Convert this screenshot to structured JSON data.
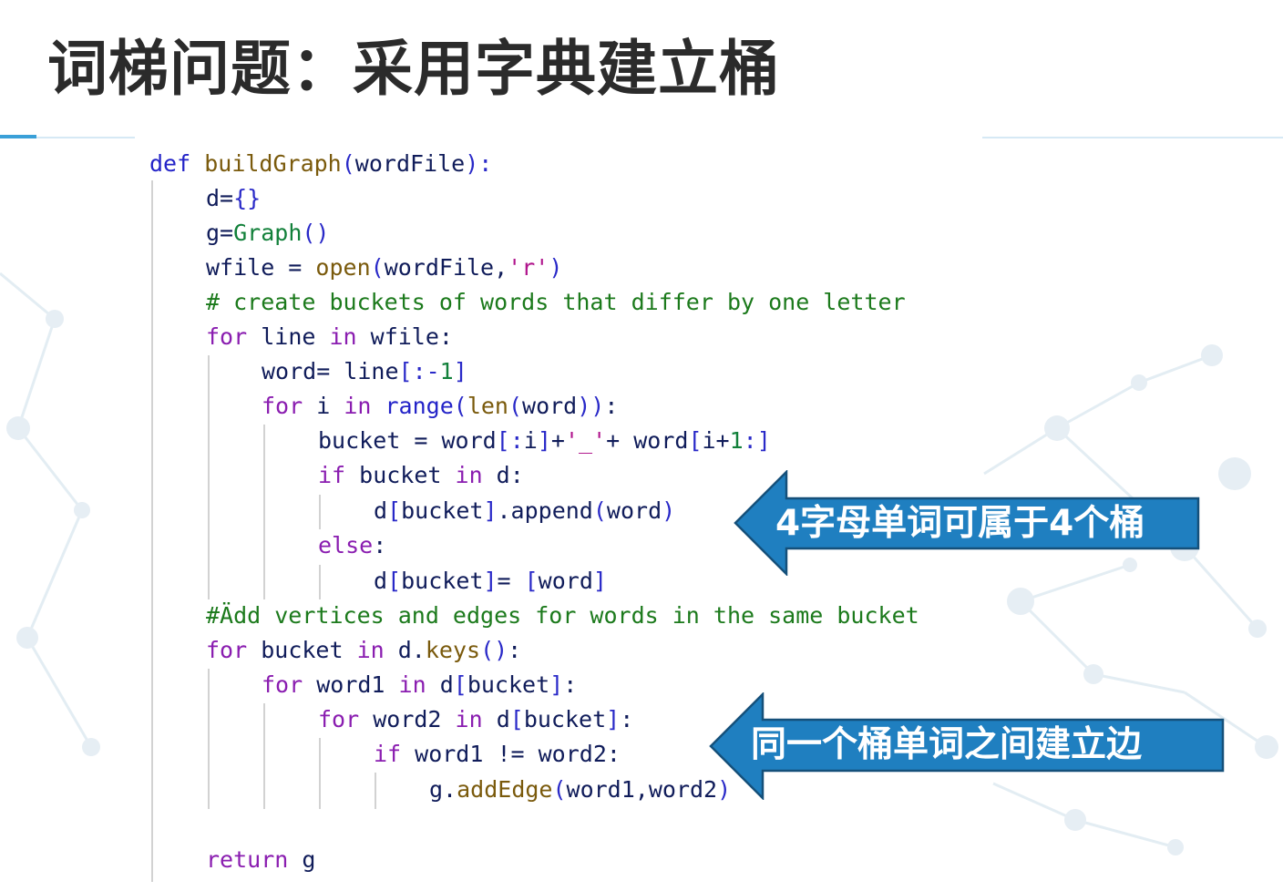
{
  "slide": {
    "title": "词梯问题：采用字典建立桶"
  },
  "code": {
    "lines": [
      [
        {
          "t": "def ",
          "c": "d"
        },
        {
          "t": "buildGraph",
          "c": "f"
        },
        {
          "t": "(",
          "c": "p"
        },
        {
          "t": "wordFile",
          "c": ""
        },
        {
          "t": "):",
          "c": "p"
        }
      ],
      [
        {
          "t": "d=",
          "c": ""
        },
        {
          "t": "{}",
          "c": "p"
        }
      ],
      [
        {
          "t": "g=",
          "c": ""
        },
        {
          "t": "Graph",
          "c": "n"
        },
        {
          "t": "()",
          "c": "p"
        }
      ],
      [
        {
          "t": "wfile = ",
          "c": ""
        },
        {
          "t": "open",
          "c": "f"
        },
        {
          "t": "(",
          "c": "p"
        },
        {
          "t": "wordFile,",
          "c": ""
        },
        {
          "t": "'r'",
          "c": "s"
        },
        {
          "t": ")",
          "c": "p"
        }
      ],
      [
        {
          "t": "# create buckets of words that differ by one letter",
          "c": "c"
        }
      ],
      [
        {
          "t": "for ",
          "c": "k"
        },
        {
          "t": "line ",
          "c": ""
        },
        {
          "t": "in ",
          "c": "k"
        },
        {
          "t": "wfile:",
          "c": ""
        }
      ],
      [
        {
          "t": "word= line",
          "c": ""
        },
        {
          "t": "[:-",
          "c": "p"
        },
        {
          "t": "1",
          "c": "n"
        },
        {
          "t": "]",
          "c": "p"
        }
      ],
      [
        {
          "t": "for ",
          "c": "k"
        },
        {
          "t": "i ",
          "c": ""
        },
        {
          "t": "in ",
          "c": "k"
        },
        {
          "t": "range",
          "c": "d"
        },
        {
          "t": "(",
          "c": "p"
        },
        {
          "t": "len",
          "c": "f"
        },
        {
          "t": "(",
          "c": "p"
        },
        {
          "t": "word",
          "c": ""
        },
        {
          "t": "))",
          "c": "p"
        },
        {
          "t": ":",
          "c": ""
        }
      ],
      [
        {
          "t": "bucket = word",
          "c": ""
        },
        {
          "t": "[:",
          "c": "p"
        },
        {
          "t": "i",
          "c": ""
        },
        {
          "t": "]",
          "c": "p"
        },
        {
          "t": "+",
          "c": ""
        },
        {
          "t": "'_'",
          "c": "s"
        },
        {
          "t": "+ word",
          "c": ""
        },
        {
          "t": "[",
          "c": "p"
        },
        {
          "t": "i+",
          "c": ""
        },
        {
          "t": "1",
          "c": "n"
        },
        {
          "t": ":]",
          "c": "p"
        }
      ],
      [
        {
          "t": "if ",
          "c": "k"
        },
        {
          "t": "bucket ",
          "c": ""
        },
        {
          "t": "in ",
          "c": "k"
        },
        {
          "t": "d:",
          "c": ""
        }
      ],
      [
        {
          "t": "d",
          "c": ""
        },
        {
          "t": "[",
          "c": "p"
        },
        {
          "t": "bucket",
          "c": ""
        },
        {
          "t": "]",
          "c": "p"
        },
        {
          "t": ".append",
          "c": ""
        },
        {
          "t": "(",
          "c": "p"
        },
        {
          "t": "word",
          "c": ""
        },
        {
          "t": ")",
          "c": "p"
        }
      ],
      [
        {
          "t": "else",
          "c": "k"
        },
        {
          "t": ":",
          "c": ""
        }
      ],
      [
        {
          "t": "d",
          "c": ""
        },
        {
          "t": "[",
          "c": "p"
        },
        {
          "t": "bucket",
          "c": ""
        },
        {
          "t": "]",
          "c": "p"
        },
        {
          "t": "= ",
          "c": ""
        },
        {
          "t": "[",
          "c": "p"
        },
        {
          "t": "word",
          "c": ""
        },
        {
          "t": "]",
          "c": "p"
        }
      ],
      [
        {
          "t": "#Ädd vertices and edges for words in the same bucket",
          "c": "c"
        }
      ],
      [
        {
          "t": "for ",
          "c": "k"
        },
        {
          "t": "bucket ",
          "c": ""
        },
        {
          "t": "in ",
          "c": "k"
        },
        {
          "t": "d.",
          "c": ""
        },
        {
          "t": "keys",
          "c": "f"
        },
        {
          "t": "()",
          "c": "p"
        },
        {
          "t": ":",
          "c": ""
        }
      ],
      [
        {
          "t": "for ",
          "c": "k"
        },
        {
          "t": "word1 ",
          "c": ""
        },
        {
          "t": "in ",
          "c": "k"
        },
        {
          "t": "d",
          "c": ""
        },
        {
          "t": "[",
          "c": "p"
        },
        {
          "t": "bucket",
          "c": ""
        },
        {
          "t": "]",
          "c": "p"
        },
        {
          "t": ":",
          "c": ""
        }
      ],
      [
        {
          "t": "for ",
          "c": "k"
        },
        {
          "t": "word2 ",
          "c": ""
        },
        {
          "t": "in ",
          "c": "k"
        },
        {
          "t": "d",
          "c": ""
        },
        {
          "t": "[",
          "c": "p"
        },
        {
          "t": "bucket",
          "c": ""
        },
        {
          "t": "]",
          "c": "p"
        },
        {
          "t": ":",
          "c": ""
        }
      ],
      [
        {
          "t": "if ",
          "c": "k"
        },
        {
          "t": "word1 != word2:",
          "c": ""
        }
      ],
      [
        {
          "t": "g.",
          "c": ""
        },
        {
          "t": "addEdge",
          "c": "f"
        },
        {
          "t": "(",
          "c": "p"
        },
        {
          "t": "word1,word2",
          "c": ""
        },
        {
          "t": ")",
          "c": "p"
        }
      ],
      [
        {
          "t": "return ",
          "c": "k"
        },
        {
          "t": "g",
          "c": ""
        }
      ]
    ]
  },
  "callouts": [
    {
      "text": "4字母单词可属于4个桶"
    },
    {
      "text": "同一个桶单词之间建立边"
    }
  ],
  "colors": {
    "callout_fill": "#1f7fc0",
    "callout_stroke": "#15507a",
    "keyword": "#8a1db0",
    "def_builtin": "#2323c8",
    "function": "#7a5a0c",
    "comment": "#1c7a1c",
    "string": "#b0148c",
    "number": "#12803a",
    "title": "#2b2b2b"
  },
  "icons": [
    "left-arrow-callout-shape"
  ]
}
